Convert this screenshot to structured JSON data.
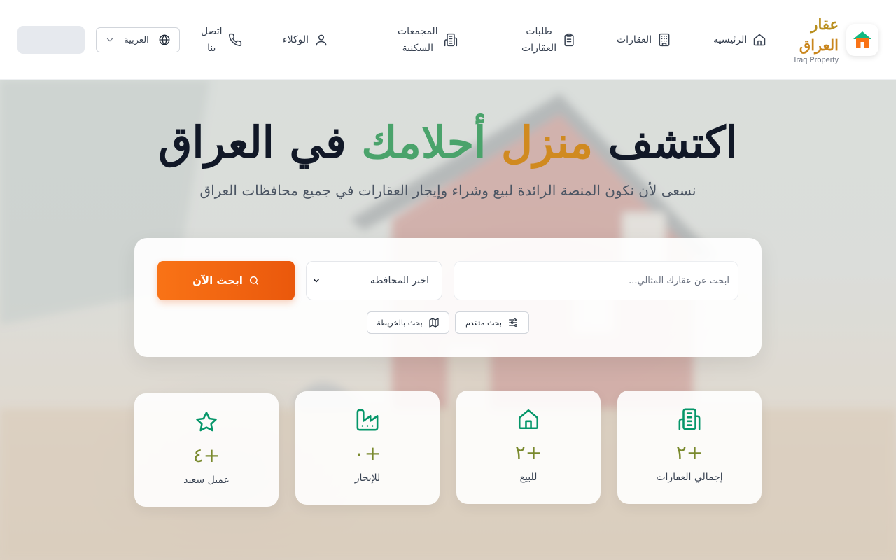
{
  "brand": {
    "name_ar_line1": "عقار",
    "name_ar_line2": "العراق",
    "name_en": "Iraq Property"
  },
  "nav": {
    "home": "الرئيسية",
    "properties": "العقارات",
    "property_requests_line1": "طلبات",
    "property_requests_line2": "العقارات",
    "residential_complexes_line1": "المجمعات",
    "residential_complexes_line2": "السكنية",
    "agents": "الوكلاء",
    "contact_line1": "اتصل",
    "contact_line2": "بنا"
  },
  "language": {
    "selected": "العربية"
  },
  "hero": {
    "title_part1": "اكتشف",
    "title_part2": "منزل",
    "title_part3": "أحلامك",
    "title_part4": "في العراق",
    "subtitle": "نسعى لأن نكون المنصة الرائدة لبيع وشراء وإيجار العقارات في جميع محافظات العراق"
  },
  "search": {
    "placeholder": "ابحث عن عقارك المثالي...",
    "governorate_selected": "اختر المحافظة",
    "button_label": "ابحث الآن",
    "advanced_label": "بحث متقدم",
    "map_label": "بحث بالخريطة"
  },
  "stats": [
    {
      "value": "+٢",
      "label": "إجمالي العقارات",
      "icon": "building-icon"
    },
    {
      "value": "+٢",
      "label": "للبيع",
      "icon": "house-icon"
    },
    {
      "value": "+٠",
      "label": "للإيجار",
      "icon": "factory-icon"
    },
    {
      "value": "+٤",
      "label": "عميل سعيد",
      "icon": "star-icon"
    }
  ],
  "colors": {
    "accent_orange": "#f97316",
    "accent_green": "#059669",
    "brand_gold": "#b98f1f",
    "stat_value": "#7a8a2e"
  }
}
